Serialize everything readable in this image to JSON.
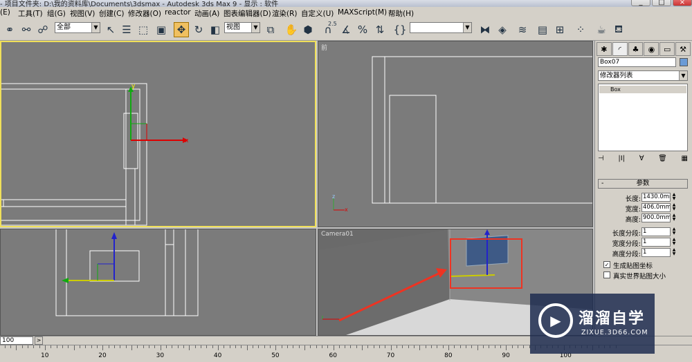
{
  "title_bar": {
    "text": "- 项目文件夹: D:\\我的资料库\\Documents\\3dsmax    - Autodesk 3ds Max 9    - 显示 : 软件",
    "min": "_",
    "max": "□",
    "close": "×"
  },
  "menu": [
    "(E)",
    "工具(T)",
    "组(G)",
    "视图(V)",
    "创建(C)",
    "修改器(O)",
    "reactor",
    "动画(A)",
    "图表编辑器(D)",
    "渲染(R)",
    "自定义(U)",
    "MAXScript(M)",
    "帮助(H)"
  ],
  "toolbar": {
    "filter_value": "全部",
    "refcoord_value": "视图",
    "named_sel_value": "",
    "icons": [
      "select-link-icon",
      "unlink-icon",
      "bind-space-warp-icon",
      "select-object-icon",
      "select-by-name-icon",
      "rect-region-icon",
      "window-crossing-icon",
      "move-icon",
      "rotate-icon",
      "scale-icon",
      "pivot-icon",
      "manipulate-icon",
      "snap-icon",
      "angle-snap-icon",
      "percent-snap-icon",
      "spinner-snap-icon",
      "edit-named-sel-icon",
      "mirror-icon",
      "align-icon",
      "layer-manager-icon",
      "curve-editor-icon",
      "schematic-icon",
      "material-editor-icon",
      "render-scene-icon",
      "quick-render-icon"
    ],
    "snap_label": "2.5",
    "active_tool": "move-icon"
  },
  "viewports": {
    "top_label": "",
    "front_label": "前",
    "left_label": "",
    "camera_label": "Camera01",
    "axis_x": "x",
    "axis_y": "y",
    "axis_z": "z"
  },
  "panel": {
    "object_name": "Box07",
    "object_color": "#6b9bd6",
    "modifier_list": "修改器列表",
    "stack_item": "Box",
    "rollout_title": "参数",
    "params": [
      {
        "label": "长度:",
        "value": "1430.0mm"
      },
      {
        "label": "宽度:",
        "value": "406.0mm"
      },
      {
        "label": "高度:",
        "value": "900.0mm"
      },
      {
        "label": "长度分段:",
        "value": "1"
      },
      {
        "label": "宽度分段:",
        "value": "1"
      },
      {
        "label": "高度分段:",
        "value": "1"
      }
    ],
    "checks": [
      {
        "label": "生成贴图坐标",
        "checked": true
      },
      {
        "label": "真实世界贴图大小",
        "checked": false
      }
    ]
  },
  "timeline": {
    "frame": "100",
    "next": ">"
  },
  "ruler": [
    "10",
    "20",
    "30",
    "40",
    "50",
    "60",
    "70",
    "80",
    "90",
    "100"
  ],
  "watermark": {
    "brand": "溜溜自学",
    "url": "ZIXUE.3D66.COM"
  }
}
